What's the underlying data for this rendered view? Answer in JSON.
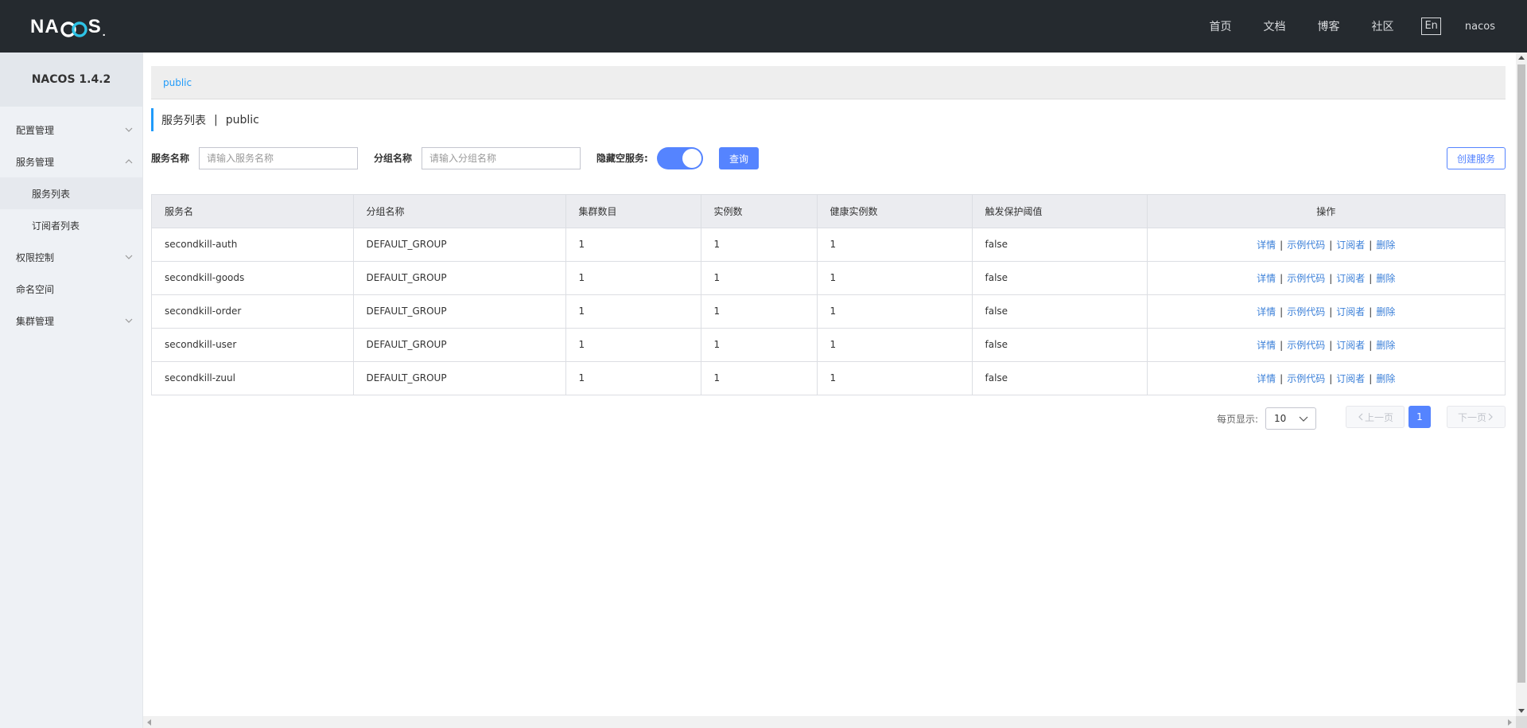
{
  "header": {
    "logo": {
      "n": "N",
      "a": "A",
      "s": "S",
      "dot": "."
    },
    "nav": [
      "首页",
      "文档",
      "博客",
      "社区"
    ],
    "lang": "En",
    "user": "nacos"
  },
  "sidebar": {
    "title": "NACOS 1.4.2",
    "items": [
      {
        "label": "配置管理",
        "expanded": false
      },
      {
        "label": "服务管理",
        "expanded": true,
        "children": [
          "服务列表",
          "订阅者列表"
        ]
      },
      {
        "label": "权限控制",
        "expanded": false
      },
      {
        "label": "命名空间"
      },
      {
        "label": "集群管理",
        "expanded": false
      }
    ]
  },
  "breadcrumb": "public",
  "page_title": {
    "main": "服务列表",
    "sep": "|",
    "namespace": "public"
  },
  "filters": {
    "service_label": "服务名称",
    "service_placeholder": "请输入服务名称",
    "group_label": "分组名称",
    "group_placeholder": "请输入分组名称",
    "hide_empty_label": "隐藏空服务:",
    "hide_empty_on": true,
    "query_button": "查询",
    "create_button": "创建服务"
  },
  "table": {
    "columns": [
      "服务名",
      "分组名称",
      "集群数目",
      "实例数",
      "健康实例数",
      "触发保护阈值",
      "操作"
    ],
    "rows": [
      [
        "secondkill-auth",
        "DEFAULT_GROUP",
        "1",
        "1",
        "1",
        "false"
      ],
      [
        "secondkill-goods",
        "DEFAULT_GROUP",
        "1",
        "1",
        "1",
        "false"
      ],
      [
        "secondkill-order",
        "DEFAULT_GROUP",
        "1",
        "1",
        "1",
        "false"
      ],
      [
        "secondkill-user",
        "DEFAULT_GROUP",
        "1",
        "1",
        "1",
        "false"
      ],
      [
        "secondkill-zuul",
        "DEFAULT_GROUP",
        "1",
        "1",
        "1",
        "false"
      ]
    ],
    "ops": [
      "详情",
      "示例代码",
      "订阅者",
      "删除"
    ],
    "op_sep": "|"
  },
  "pagination": {
    "page_size_label": "每页显示:",
    "page_size": "10",
    "prev": "上一页",
    "next": "下一页",
    "current": "1"
  },
  "colors": {
    "header_bg": "#252a2f",
    "primary": "#5584ff",
    "link": "#3a7fd8",
    "accent": "#209bfa"
  }
}
